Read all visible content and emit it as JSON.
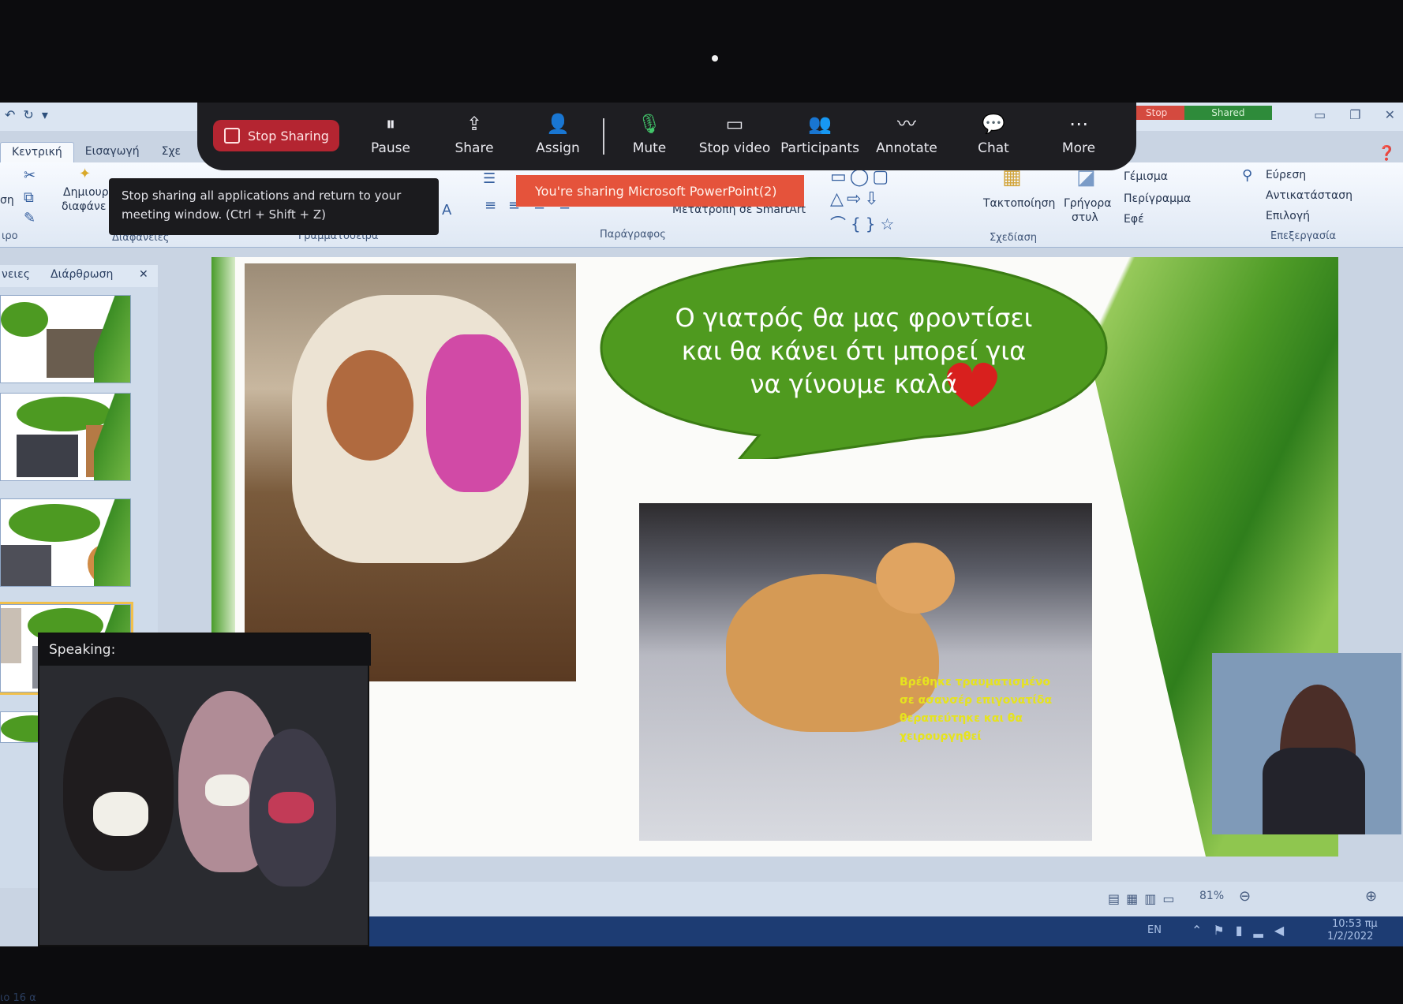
{
  "zoom_toolbar": {
    "stop_sharing": "Stop Sharing",
    "pause": "Pause",
    "share": "Share",
    "assign": "Assign",
    "mute": "Mute",
    "stop_video": "Stop video",
    "participants": "Participants",
    "annotate": "Annotate",
    "chat": "Chat",
    "more": "More"
  },
  "stop_shared_tabs": {
    "stop": "Stop",
    "shared": "Shared"
  },
  "tooltip": "Stop sharing all applications and return to your meeting window. (Ctrl + Shift + Z)",
  "sharing_banner": "You're sharing Microsoft PowerPoint(2)",
  "ppt": {
    "tabs": [
      "Κεντρική",
      "Εισαγωγή",
      "Σχε"
    ],
    "groups": {
      "slides": "Διαφάνειες",
      "font": "Γραμματοσειρά",
      "paragraph": "Παράγραφος",
      "drawing": "Σχεδίαση",
      "editing": "Επεξεργασία"
    },
    "new_slide": [
      "Δημιουρ",
      "διαφάνε"
    ],
    "smartart": "Μετατροπή σε SmartArt",
    "arrange": "Τακτοποίηση",
    "quick_styles": [
      "Γρήγορα",
      "στυλ"
    ],
    "fill": "Γέμισμα",
    "outline": "Περίγραμμα",
    "effects": "Εφέ",
    "find": "Εύρεση",
    "replace": "Αντικατάσταση",
    "select": "Επιλογή",
    "left_cut_labels": [
      "ση",
      "ιρο"
    ],
    "panel_tabs": [
      "νειες",
      "Διάρθρωση"
    ]
  },
  "slide": {
    "bubble_text": [
      "Ο γιατρός θα μας φροντίσει",
      "και θα κάνει ότι μπορεί για",
      "να γίνουμε καλά"
    ],
    "cat_caption": [
      "Βρέθηκε τραυματισμένο",
      "σε ασανσέρ επιγονατίδα",
      "θεραπεύτηκε και θα",
      "χειρουργηθεί"
    ],
    "heart_color": "#d8201e",
    "bubble_color": "#4f9a1f"
  },
  "video": {
    "speaking_label": "Speaking:"
  },
  "statusbar": {
    "zoom": "81%",
    "page_fragment": "ιο 16 α"
  },
  "taskbar": {
    "lang": "EN",
    "time": "10:53 πμ",
    "date": "1/2/2022"
  }
}
